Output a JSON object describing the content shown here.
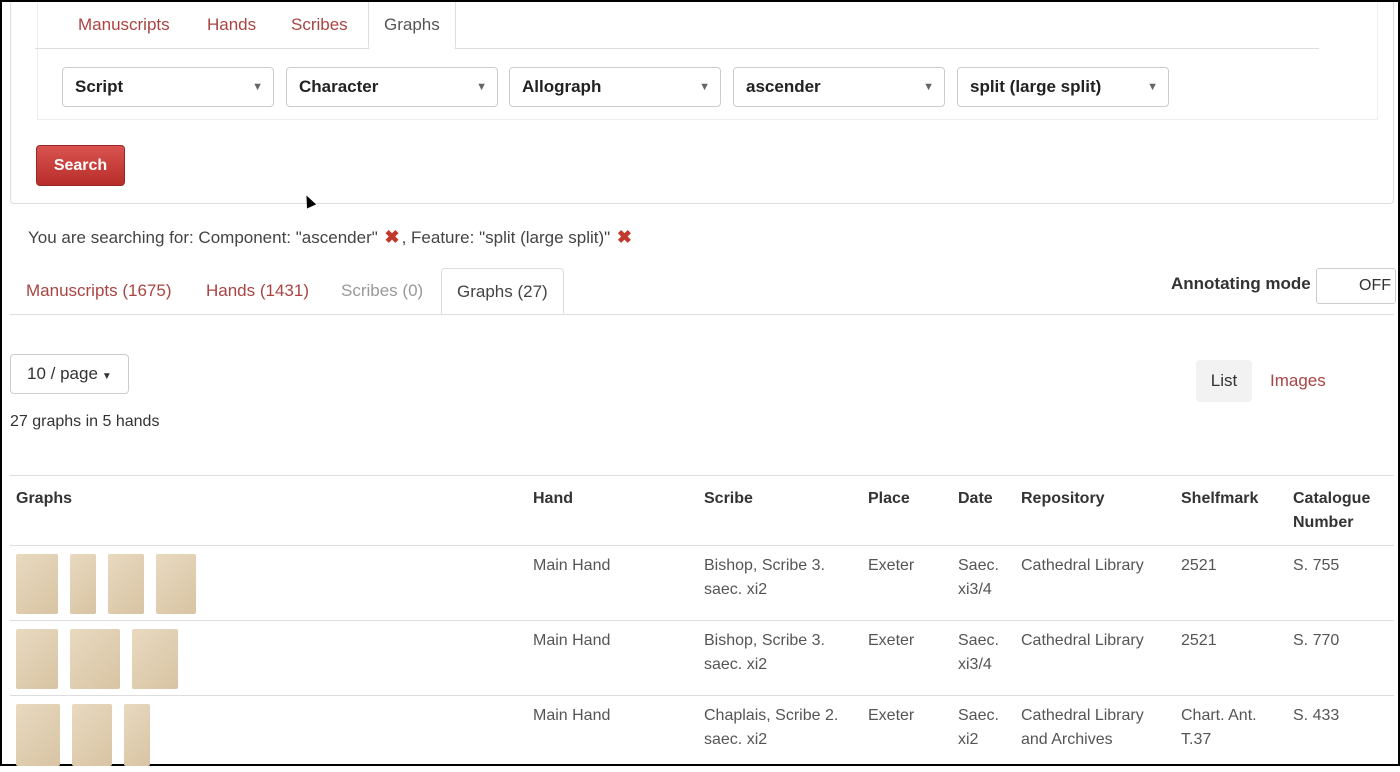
{
  "top_tabs": [
    "Manuscripts",
    "Hands",
    "Scribes",
    "Graphs"
  ],
  "filters": [
    "Script",
    "Character",
    "Allograph",
    "ascender",
    "split (large split)"
  ],
  "search_label": "Search",
  "searching": {
    "prefix": "You are searching for: Component: \"ascender\"",
    "middle": ", Feature: \"split (large split)\""
  },
  "result_tabs": [
    "Manuscripts (1675)",
    "Hands (1431)",
    "Scribes (0)",
    "Graphs (27)"
  ],
  "annotating": {
    "label": "Annotating mode",
    "state": "OFF"
  },
  "per_page": "10 / page",
  "view": {
    "list": "List",
    "images": "Images"
  },
  "summary": "27 graphs in 5 hands",
  "table": {
    "headers": [
      "Graphs",
      "Hand",
      "Scribe",
      "Place",
      "Date",
      "Repository",
      "Shelfmark",
      "Catalogue Number"
    ],
    "rows": [
      {
        "hand": "Main Hand",
        "scribe": "Bishop, Scribe 3. saec. xi2",
        "place": "Exeter",
        "date": "Saec. xi3/4",
        "repository": "Cathedral Library",
        "shelfmark": "2521",
        "catalogue": "S. 755"
      },
      {
        "hand": "Main Hand",
        "scribe": "Bishop, Scribe 3. saec. xi2",
        "place": "Exeter",
        "date": "Saec. xi3/4",
        "repository": "Cathedral Library",
        "shelfmark": "2521",
        "catalogue": "S. 770"
      },
      {
        "hand": "Main Hand",
        "scribe": "Chaplais, Scribe 2. saec. xi2",
        "place": "Exeter",
        "date": "Saec. xi2",
        "repository": "Cathedral Library and Archives",
        "shelfmark": "Chart. Ant. T.37",
        "catalogue": "S. 433"
      }
    ]
  },
  "colors": {
    "accent": "#a94442",
    "button": "#c9302c"
  }
}
